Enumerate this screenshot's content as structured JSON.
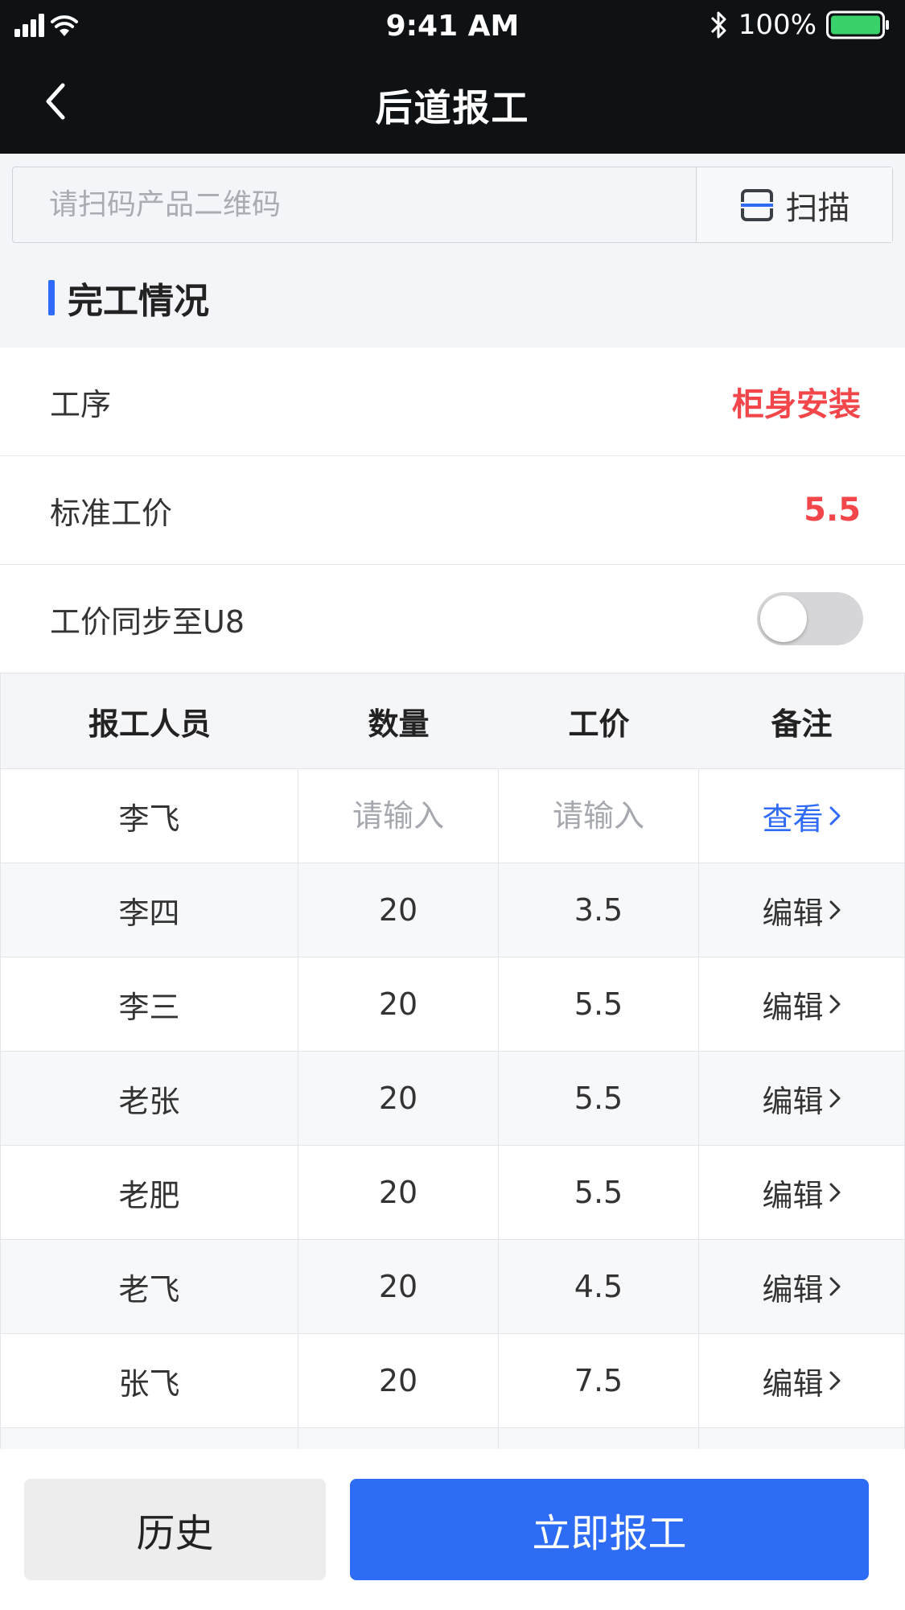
{
  "status_bar": {
    "time": "9:41 AM",
    "battery": "100%"
  },
  "nav": {
    "title": "后道报工"
  },
  "scan": {
    "placeholder": "请扫码产品二维码",
    "button_label": "扫描"
  },
  "section": {
    "title": "完工情况"
  },
  "info": {
    "process_label": "工序",
    "process_value": "柜身安装",
    "std_price_label": "标准工价",
    "std_price_value": "5.5",
    "sync_label": "工价同步至U8",
    "sync_enabled": false
  },
  "table": {
    "headers": [
      "报工人员",
      "数量",
      "工价",
      "备注"
    ],
    "input_row": {
      "worker": "李飞",
      "quantity_placeholder": "请输入",
      "price_placeholder": "请输入",
      "action": "查看"
    },
    "rows": [
      {
        "worker": "李四",
        "quantity": "20",
        "price": "3.5",
        "action": "编辑"
      },
      {
        "worker": "李三",
        "quantity": "20",
        "price": "5.5",
        "action": "编辑"
      },
      {
        "worker": "老张",
        "quantity": "20",
        "price": "5.5",
        "action": "编辑"
      },
      {
        "worker": "老肥",
        "quantity": "20",
        "price": "5.5",
        "action": "编辑"
      },
      {
        "worker": "老飞",
        "quantity": "20",
        "price": "4.5",
        "action": "编辑"
      },
      {
        "worker": "张飞",
        "quantity": "20",
        "price": "7.5",
        "action": "编辑"
      }
    ]
  },
  "buttons": {
    "history": "历史",
    "report": "立即报工"
  },
  "colors": {
    "accent": "#2f6bf6",
    "highlight": "#f2464b",
    "topbar": "#0f1214"
  }
}
